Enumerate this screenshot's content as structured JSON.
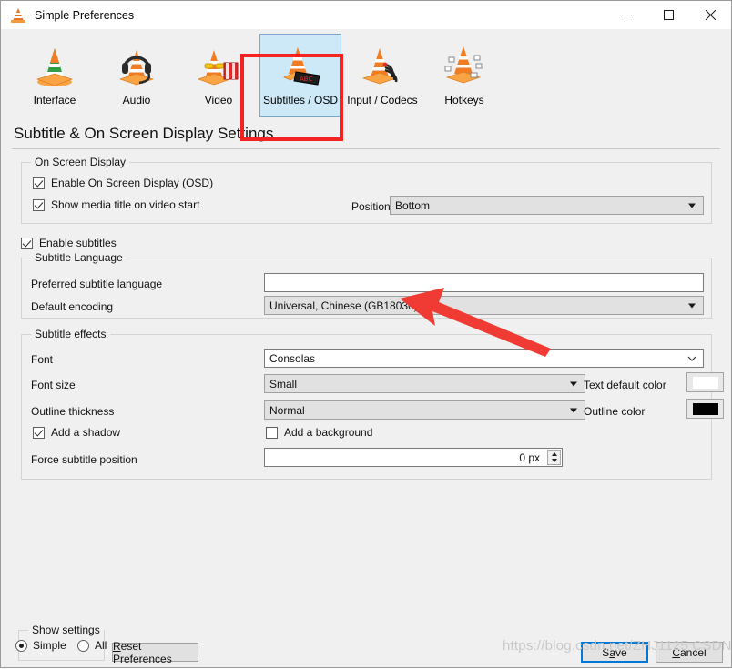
{
  "window": {
    "title": "Simple Preferences",
    "icon": "vlc-cone-icon",
    "controls": {
      "minimize": "minimize",
      "maximize": "maximize",
      "close": "close"
    }
  },
  "toolbar": {
    "items": [
      {
        "label": "Interface",
        "icon": "vlc-interface-icon",
        "selected": false
      },
      {
        "label": "Audio",
        "icon": "vlc-audio-icon",
        "selected": false
      },
      {
        "label": "Video",
        "icon": "vlc-video-icon",
        "selected": false
      },
      {
        "label": "Subtitles / OSD",
        "icon": "vlc-subtitles-icon",
        "selected": true
      },
      {
        "label": "Input / Codecs",
        "icon": "vlc-input-codecs-icon",
        "selected": false
      },
      {
        "label": "Hotkeys",
        "icon": "vlc-hotkeys-icon",
        "selected": false
      }
    ]
  },
  "page": {
    "heading": "Subtitle & On Screen Display Settings"
  },
  "osd_group": {
    "legend": "On Screen Display",
    "enable_osd": {
      "label": "Enable On Screen Display (OSD)",
      "checked": true
    },
    "show_title": {
      "label": "Show media title on video start",
      "checked": true
    },
    "position_label": "Position",
    "position_value": "Bottom"
  },
  "enable_subtitles": {
    "label": "Enable subtitles",
    "checked": true
  },
  "language_group": {
    "legend": "Subtitle Language",
    "preferred_label": "Preferred subtitle language",
    "preferred_value": "",
    "preferred_placeholder": "",
    "encoding_label": "Default encoding",
    "encoding_value": "Universal, Chinese (GB18030)"
  },
  "effects_group": {
    "legend": "Subtitle effects",
    "font_label": "Font",
    "font_value": "Consolas",
    "font_size_label": "Font size",
    "font_size_value": "Small",
    "outline_thickness_label": "Outline thickness",
    "outline_thickness_value": "Normal",
    "add_shadow": {
      "label": "Add a shadow",
      "checked": true
    },
    "add_background": {
      "label": "Add a background",
      "checked": false
    },
    "force_position_label": "Force subtitle position",
    "force_position_value": "0 px",
    "text_color_label": "Text default color",
    "text_color_value": "#ffffff",
    "outline_color_label": "Outline color",
    "outline_color_value": "#000000"
  },
  "footer": {
    "show_settings_legend": "Show settings",
    "simple_label": "Simple",
    "all_label": "All",
    "simple_selected": true,
    "all_selected": false,
    "reset_label": "Reset Preferences",
    "reset_mnemonic": "R",
    "save_label": "Save",
    "save_mnemonic": "a",
    "cancel_label": "Cancel",
    "cancel_mnemonic": "C"
  },
  "annotations": {
    "highlight_color": "#f52222",
    "arrow_color": "#ef3b33",
    "watermark": "https://blog.csdn.net/ZHJ1125 CSDN"
  }
}
